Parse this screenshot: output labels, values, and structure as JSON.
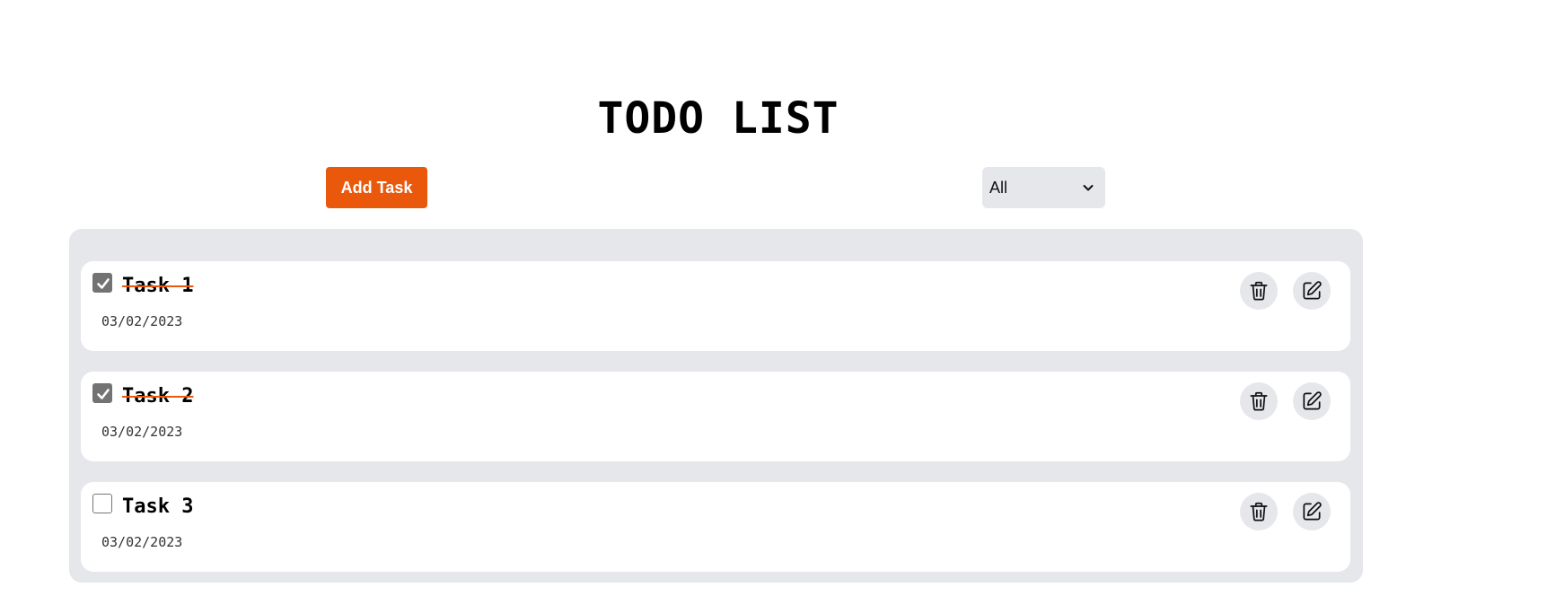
{
  "app": {
    "title": "TODO LIST"
  },
  "toolbar": {
    "add_label": "Add Task",
    "filter_selected": "All",
    "add_button_color": "#ea580c"
  },
  "tasks": [
    {
      "title": "Task 1",
      "date": "03/02/2023",
      "completed": true
    },
    {
      "title": "Task 2",
      "date": "03/02/2023",
      "completed": true
    },
    {
      "title": "Task 3",
      "date": "03/02/2023",
      "completed": false
    }
  ],
  "icons": {
    "delete": "trash-icon",
    "edit": "edit-icon",
    "filter": "chevron-down-icon",
    "check": "check-icon"
  },
  "colors": {
    "panel_bg": "#e5e7eb",
    "strike": "#ea580c"
  }
}
